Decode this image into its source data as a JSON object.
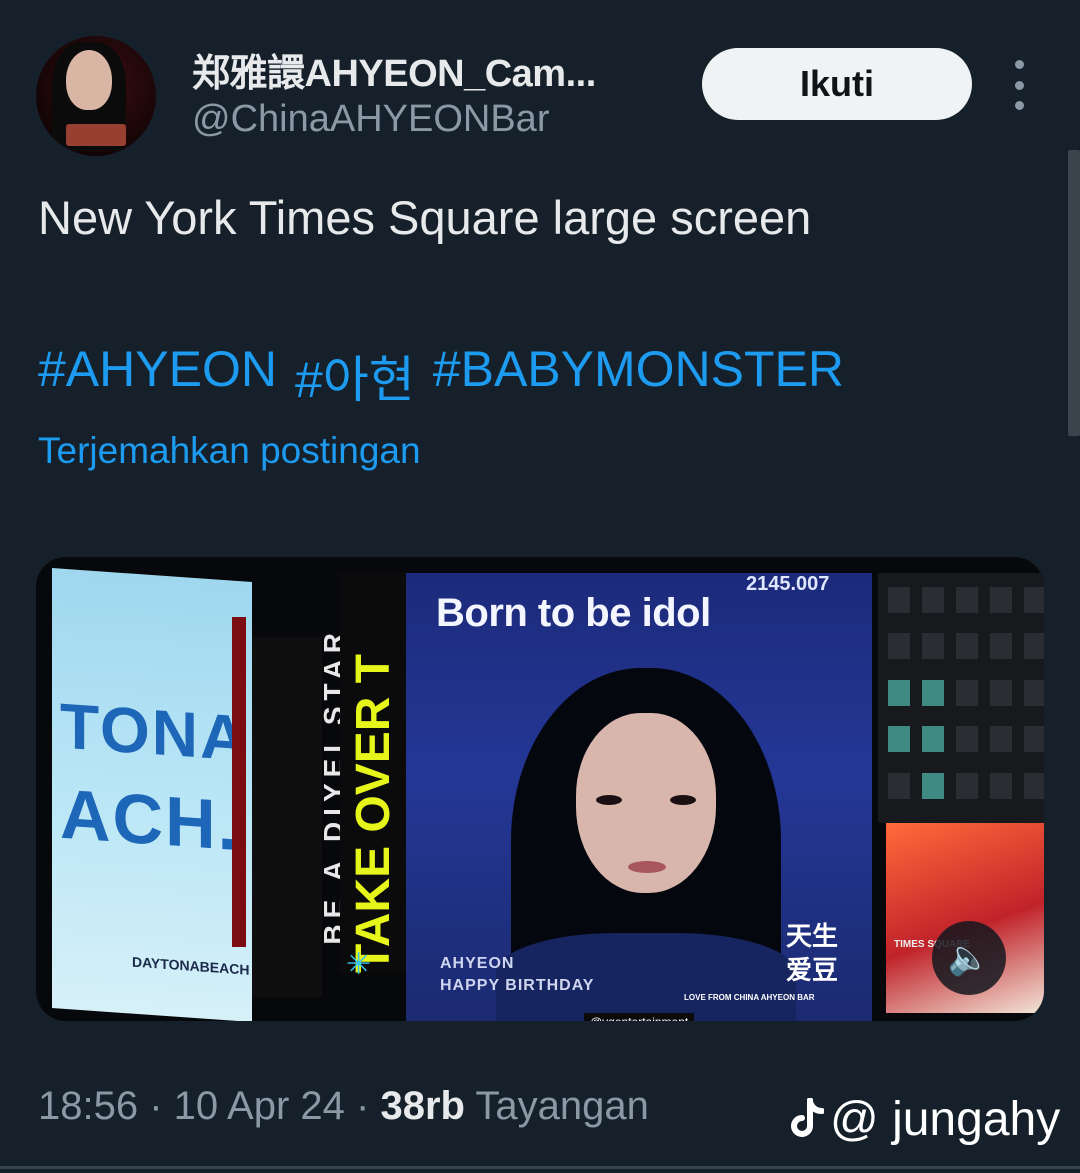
{
  "user": {
    "display_name": "郑雅譞AHYEON_Cam...",
    "handle": "@ChinaAHYEONBar"
  },
  "follow_label": "Ikuti",
  "tweet": {
    "text": "New York Times Square large screen",
    "hashtags": [
      "#AHYEON",
      "#아현",
      "#BABYMONSTER"
    ],
    "translate_label": "Terjemahkan postingan"
  },
  "media": {
    "left_billboard": [
      "TONA",
      "ACH.",
      "DAYTONABEACH"
    ],
    "vertical_texts": [
      "BE A DIYEI STAR",
      "TAKE OVER T"
    ],
    "main_title": "Born to be idol",
    "counter": "2145.007",
    "birthday_lines": [
      "AHYEON",
      "HAPPY BIRTHDAY"
    ],
    "chinese_lines": [
      "天生",
      "爱豆"
    ],
    "love_from": "LOVE FROM CHINA AHYEON BAR",
    "instagram": "@ygentertainment",
    "square_sign": "TIMES SQUARE"
  },
  "meta": {
    "time": "18:56",
    "date": "10 Apr 24",
    "views_count": "38rb",
    "views_label": "Tayangan"
  },
  "watermark": "@ jungahy",
  "colors": {
    "background": "#15202b",
    "link": "#1d9bf0",
    "muted": "#8b98a5",
    "text": "#e7e9ea",
    "follow_button": "#eff3f4"
  }
}
